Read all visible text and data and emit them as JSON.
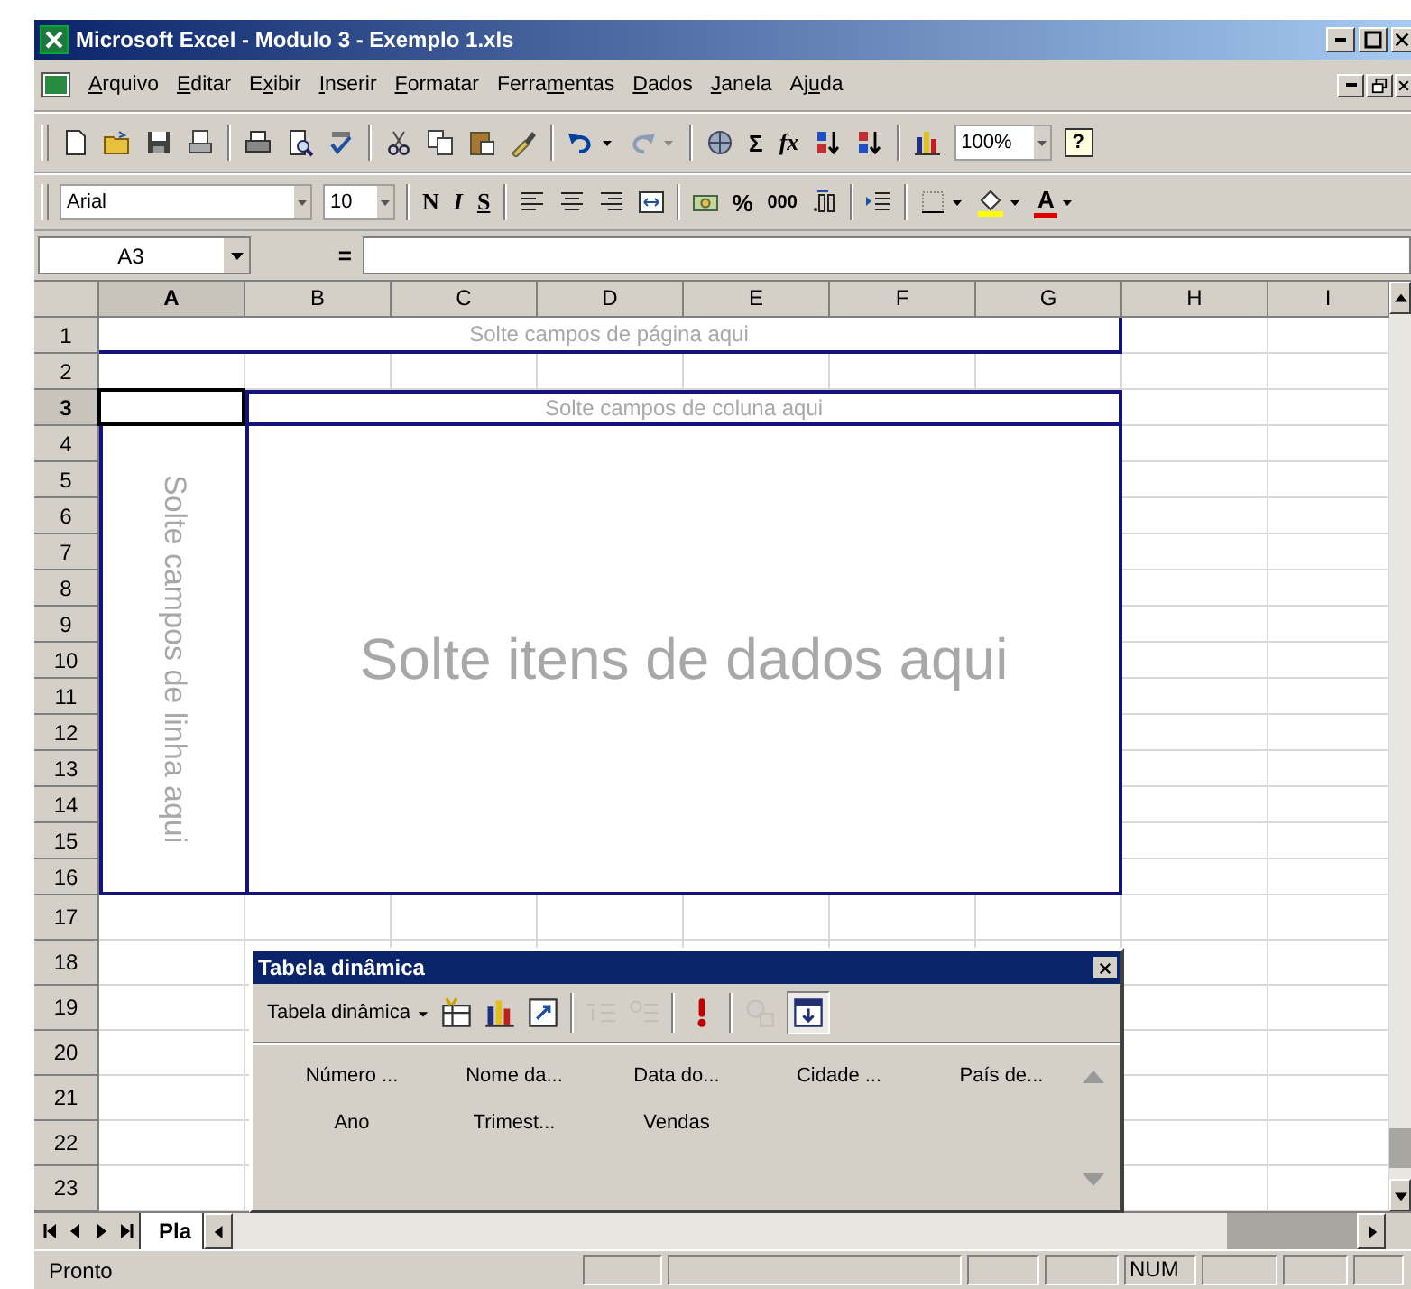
{
  "window": {
    "title": "Microsoft Excel - Modulo 3 - Exemplo 1.xls"
  },
  "menu": [
    {
      "hotkey": "A",
      "after": "rquivo"
    },
    {
      "hotkey": "E",
      "after": "ditar"
    },
    {
      "before": "E",
      "hotkey": "x",
      "after": "ibir"
    },
    {
      "hotkey": "I",
      "after": "nserir"
    },
    {
      "hotkey": "F",
      "after": "ormatar"
    },
    {
      "before": "Ferra",
      "hotkey": "m",
      "after": "entas"
    },
    {
      "hotkey": "D",
      "after": "ados"
    },
    {
      "hotkey": "J",
      "after": "anela"
    },
    {
      "before": "Aj",
      "hotkey": "u",
      "after": "da"
    }
  ],
  "standard_toolbar": [
    {
      "kind": "new",
      "disabled": false
    },
    {
      "kind": "open",
      "disabled": false
    },
    {
      "kind": "save",
      "disabled": false
    },
    {
      "kind": "permission",
      "disabled": false
    },
    {
      "kind": "separator"
    },
    {
      "kind": "print",
      "disabled": false
    },
    {
      "kind": "preview",
      "disabled": false
    },
    {
      "kind": "spelling",
      "disabled": false
    },
    {
      "kind": "separator"
    },
    {
      "kind": "cut",
      "disabled": false
    },
    {
      "kind": "copy",
      "disabled": false
    },
    {
      "kind": "paste",
      "disabled": false
    },
    {
      "kind": "painter",
      "disabled": false
    },
    {
      "kind": "separator"
    },
    {
      "kind": "undo",
      "disabled": false
    },
    {
      "kind": "dropdown",
      "disabled": false
    },
    {
      "kind": "redo",
      "disabled": true
    },
    {
      "kind": "dropdown",
      "disabled": true
    },
    {
      "kind": "separator"
    },
    {
      "kind": "hyperlink",
      "disabled": false
    },
    {
      "kind": "text",
      "label": "Σ",
      "disabled": false
    },
    {
      "kind": "function",
      "label": "fx",
      "disabled": false
    },
    {
      "kind": "sort-asc",
      "disabled": false
    },
    {
      "kind": "sort-desc",
      "disabled": false
    },
    {
      "kind": "separator"
    },
    {
      "kind": "chart",
      "disabled": false
    },
    {
      "kind": "zoom",
      "value": "100%",
      "disabled": false
    },
    {
      "kind": "help",
      "label": "?",
      "disabled": false
    }
  ],
  "formatting_toolbar": [
    {
      "kind": "font",
      "value": "Arial"
    },
    {
      "kind": "size",
      "value": "10"
    },
    {
      "kind": "separator"
    },
    {
      "kind": "bold",
      "label": "N"
    },
    {
      "kind": "italic",
      "label": "I"
    },
    {
      "kind": "underline",
      "label": "S"
    },
    {
      "kind": "separator"
    },
    {
      "kind": "align-left"
    },
    {
      "kind": "align-center"
    },
    {
      "kind": "align-right"
    },
    {
      "kind": "merge"
    },
    {
      "kind": "separator"
    },
    {
      "kind": "currency"
    },
    {
      "kind": "percent",
      "label": "%"
    },
    {
      "kind": "thousands",
      "label": "000"
    },
    {
      "kind": "inc-decimal"
    },
    {
      "kind": "separator"
    },
    {
      "kind": "indent"
    },
    {
      "kind": "separator"
    },
    {
      "kind": "borders"
    },
    {
      "kind": "dropdown"
    },
    {
      "kind": "fill"
    },
    {
      "kind": "dropdown"
    },
    {
      "kind": "fontcolor",
      "label": "A"
    },
    {
      "kind": "dropdown"
    }
  ],
  "formula_bar": {
    "name_box": "A3",
    "equals": "="
  },
  "sheet": {
    "columns": [
      {
        "label": "A",
        "selected": true
      },
      {
        "label": "B",
        "selected": false
      },
      {
        "label": "C",
        "selected": false
      },
      {
        "label": "D",
        "selected": false
      },
      {
        "label": "E",
        "selected": false
      },
      {
        "label": "F",
        "selected": false
      },
      {
        "label": "G",
        "selected": false
      },
      {
        "label": "H",
        "selected": false
      },
      {
        "label": "I",
        "selected": false
      }
    ],
    "rows": [
      {
        "label": "1",
        "selected": false
      },
      {
        "label": "2",
        "selected": false
      },
      {
        "label": "3",
        "selected": true
      },
      {
        "label": "4",
        "selected": false
      },
      {
        "label": "5",
        "selected": false
      },
      {
        "label": "6",
        "selected": false
      },
      {
        "label": "7",
        "selected": false
      },
      {
        "label": "8",
        "selected": false
      },
      {
        "label": "9",
        "selected": false
      },
      {
        "label": "10",
        "selected": false
      },
      {
        "label": "11",
        "selected": false
      },
      {
        "label": "12",
        "selected": false
      },
      {
        "label": "13",
        "selected": false
      },
      {
        "label": "14",
        "selected": false
      },
      {
        "label": "15",
        "selected": false
      },
      {
        "label": "16",
        "selected": false
      },
      {
        "label": "17",
        "selected": false
      },
      {
        "label": "18",
        "selected": false
      },
      {
        "label": "19",
        "selected": false
      },
      {
        "label": "20",
        "selected": false
      },
      {
        "label": "21",
        "selected": false
      },
      {
        "label": "22",
        "selected": false
      },
      {
        "label": "23",
        "selected": false
      }
    ]
  },
  "pivot_areas": {
    "page": "Solte campos de página aqui",
    "column": "Solte campos de coluna aqui",
    "row": "Solte campos de linha aqui",
    "data": "Solte itens de dados aqui"
  },
  "pivot_toolbar": {
    "title": "Tabela dinâmica",
    "menu": "Tabela dinâmica",
    "tools": [
      {
        "kind": "format-report",
        "disabled": false,
        "pressed": false
      },
      {
        "kind": "chart",
        "disabled": false,
        "pressed": false
      },
      {
        "kind": "wizard",
        "disabled": false,
        "pressed": false
      },
      {
        "kind": "separator"
      },
      {
        "kind": "hide-detail",
        "disabled": true,
        "pressed": false
      },
      {
        "kind": "show-detail",
        "disabled": true,
        "pressed": false
      },
      {
        "kind": "separator"
      },
      {
        "kind": "refresh",
        "disabled": false,
        "pressed": false
      },
      {
        "kind": "separator"
      },
      {
        "kind": "field-settings",
        "disabled": true,
        "pressed": false
      },
      {
        "kind": "field-list",
        "disabled": false,
        "pressed": true
      }
    ],
    "fields": [
      "Número ...",
      "Nome da...",
      "Data do...",
      "Cidade ...",
      "País de...",
      "Ano",
      "Trimest...",
      "Vendas"
    ]
  },
  "sheet_tabs": [
    {
      "label": "Pla",
      "selected": true
    }
  ],
  "status_bar": {
    "text": "Pronto",
    "indicator": "NUM"
  }
}
